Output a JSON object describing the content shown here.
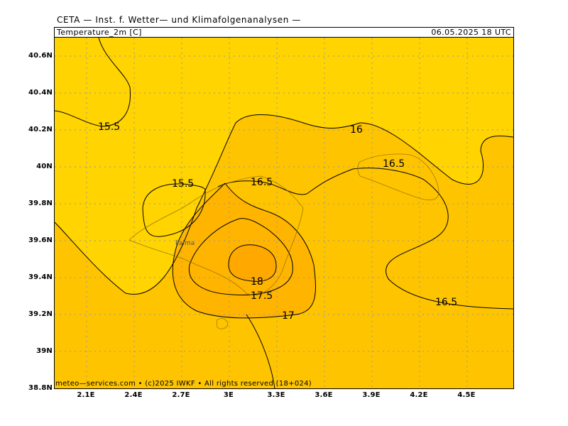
{
  "header": {
    "source": "CETA — Inst. f. Wetter— und Klimafolgenanalysen —",
    "parameter": "Temperature_2m [C]",
    "valid_time": "06.05.2025  18 UTC"
  },
  "footer": {
    "copyright": "meteo—services.com • (c)2025 IWKF • All rights reserved (18+024)"
  },
  "axes": {
    "y_labels": [
      "40.6N",
      "40.4N",
      "40.2N",
      "40N",
      "39.8N",
      "39.6N",
      "39.4N",
      "39.2N",
      "39N",
      "38.8N"
    ],
    "x_labels": [
      "2.1E",
      "2.4E",
      "2.7E",
      "3E",
      "3.3E",
      "3.6E",
      "3.9E",
      "4.2E",
      "4.5E"
    ]
  },
  "contour_labels": {
    "c155_a": "15.5",
    "c155_b": "15.5",
    "c16": "16",
    "c165_a": "16.5",
    "c165_b": "16.5",
    "c165_c": "16.5",
    "c17": "17",
    "c175": "17.5",
    "c18": "18"
  },
  "city": "Palma",
  "colors": {
    "band_15_16": "#ffd400",
    "band_16_17": "#ffc400",
    "band_17_18": "#ffb400",
    "band_18": "#ffa800",
    "grid": "#9a9a9a"
  }
}
